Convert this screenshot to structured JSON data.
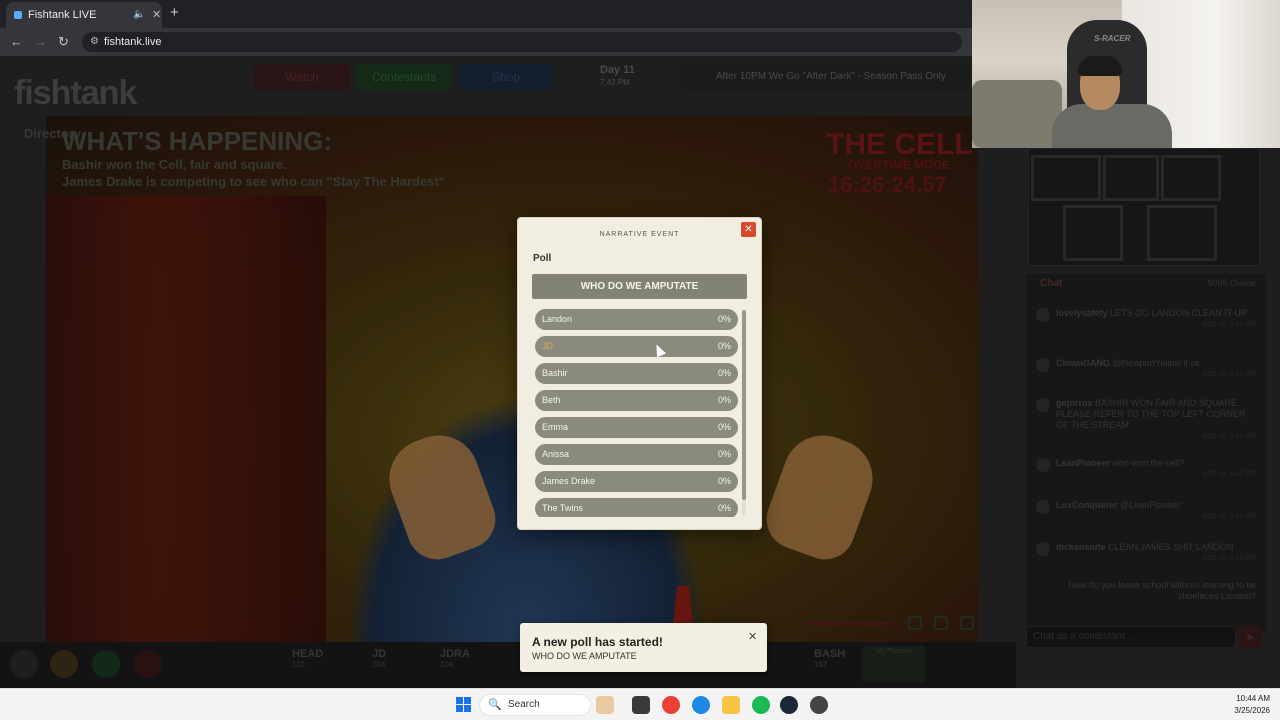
{
  "browser": {
    "tab_title": "Fishtank LIVE",
    "mute_icon": "🔈",
    "close_icon": "✕",
    "new_tab_icon": "+",
    "url": "fishtank.live"
  },
  "site": {
    "brand": "fishtank",
    "nav": {
      "watch": "Watch",
      "contestants": "Contestants",
      "shop": "Shop"
    },
    "day": "Day 11",
    "day_time": "7:42 PM",
    "marquee": "After 10PM We Go \"After Dark\" - Season Pass Only",
    "directory": "Directory"
  },
  "stream": {
    "happening_title": "WHAT'S HAPPENING:",
    "happening_lines": [
      "Bashir won the Cell, fair and square.",
      "James Drake is competing to see who can \"Stay The Hardest\""
    ],
    "cell_title": "THE CELL",
    "cell_mode": "OVERTIME MODE",
    "cell_timer": "16:26:24.57"
  },
  "modal": {
    "category": "NARRATIVE EVENT",
    "close_label": "✕",
    "poll_label": "Poll",
    "question": "WHO DO WE AMPUTATE",
    "options": [
      {
        "label": "Landon",
        "pct": "0%"
      },
      {
        "label": "JD",
        "pct": "0%"
      },
      {
        "label": "Bashir",
        "pct": "0%"
      },
      {
        "label": "Beth",
        "pct": "0%"
      },
      {
        "label": "Emma",
        "pct": "0%"
      },
      {
        "label": "Anissa",
        "pct": "0%"
      },
      {
        "label": "James Drake",
        "pct": "0%"
      },
      {
        "label": "The Twins",
        "pct": "0%"
      }
    ]
  },
  "toast": {
    "title": "A new poll has started!",
    "subtitle": "WHO DO WE AMPUTATE",
    "close_label": "✕"
  },
  "chat": {
    "title": "Chat",
    "online": "9095 Online",
    "input_placeholder": "Chat as a contestant...",
    "send_icon": "➤",
    "messages": [
      {
        "user": "lovelysafety",
        "text": "LETS GO LANDON CLEAN IT UP",
        "time": "3:25:26, 5:42 PM"
      },
      {
        "user": "ClownGANG",
        "text": "@NewportYellow it ok",
        "time": "3:25:26, 5:42 PM"
      },
      {
        "user": "gojorrox",
        "text": "BASHIR WON FAIR AND SQUARE. PLEASE REFER TO THE TOP LEFT CORNER OF THE STREAM",
        "time": "3:25:26, 5:42 PM"
      },
      {
        "user": "LeanPioneer",
        "text": "who won the cell?",
        "time": "3:25:26, 5:42 PM"
      },
      {
        "user": "LuxConquerer",
        "text": "@LeanPioneer",
        "time": "3:25:26, 5:42 PM"
      },
      {
        "user": "dickensnife",
        "text": "CLEAN JAMES SHIT LANDON",
        "time": "3:25:26, 5:43 PM"
      },
      {
        "user": "",
        "text": "How do you leave school without learning to tie shoelaces Landon?",
        "time": ""
      }
    ]
  },
  "vote_bar": {
    "columns": [
      {
        "name": "HEAD",
        "votes": "110"
      },
      {
        "name": "JD",
        "votes": "104"
      },
      {
        "name": "JDRA",
        "votes": "104"
      },
      {
        "name": "BASH",
        "votes": "182"
      }
    ],
    "my_position": "My Position"
  },
  "taskbar": {
    "search_label": "Search",
    "search_icon": "🔍",
    "time": "10:44 AM",
    "date": "3/25/2026"
  },
  "webcam": {
    "chair_label": "S-RACER"
  },
  "colors": {
    "accent_red": "#d84a2c",
    "poll_option": "#8a8a7d",
    "poll_question": "#838375",
    "modal_bg": "#f1ede1",
    "highlight_text": "#d6b04a"
  }
}
